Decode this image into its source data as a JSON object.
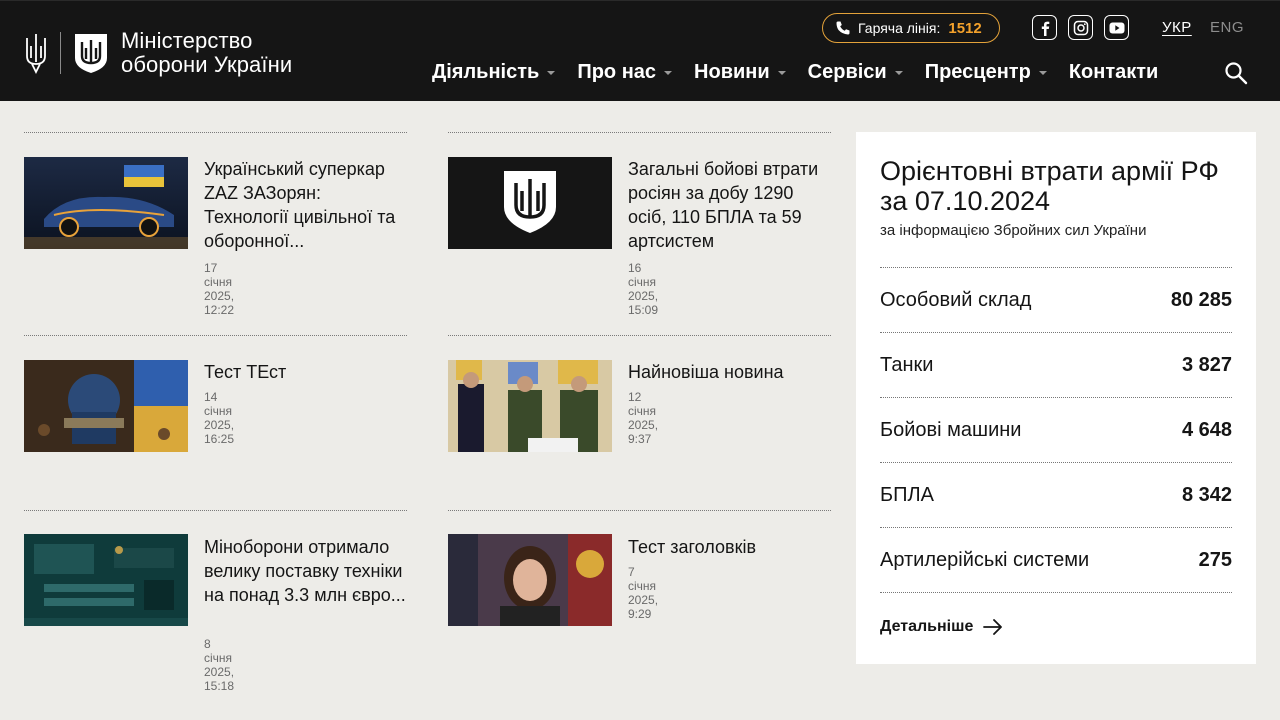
{
  "header": {
    "logo_line1": "Міністерство",
    "logo_line2": "оборони України",
    "hotline_label": "Гаряча лінія:",
    "hotline_number": "1512",
    "lang_ukr": "УКР",
    "lang_eng": "ENG",
    "nav": [
      {
        "label": "Діяльність",
        "dropdown": true
      },
      {
        "label": "Про нас",
        "dropdown": true
      },
      {
        "label": "Новини",
        "dropdown": true
      },
      {
        "label": "Сервіси",
        "dropdown": true
      },
      {
        "label": "Пресцентр",
        "dropdown": true
      },
      {
        "label": "Контакти",
        "dropdown": false
      }
    ]
  },
  "news": [
    {
      "title": "Український суперкар ZAZ ЗАЗорян: Технології цивільної та оборонної...",
      "date": "17 січня 2025, 12:22"
    },
    {
      "title": "Загальні бойові втрати росіян за добу 1290 осіб, 110 БПЛА та 59 артсистем",
      "date": "16 січня 2025, 15:09"
    },
    {
      "title": "Тест ТЕст",
      "date": "14 січня 2025, 16:25"
    },
    {
      "title": "Найновіша новина",
      "date": "12 січня 2025, 9:37"
    },
    {
      "title": "Міноборони отримало велику поставку техніки на понад 3.3 млн євро...",
      "date": "8 січня 2025, 15:18"
    },
    {
      "title": "Тест заголовків",
      "date": "7 січня 2025, 9:29"
    }
  ],
  "losses": {
    "title": "Орієнтовні втрати армії РФ за 07.10.2024",
    "subtitle": "за інформацією Збройних сил України",
    "rows": [
      {
        "label": "Особовий склад",
        "value": "80 285"
      },
      {
        "label": "Танки",
        "value": "3 827"
      },
      {
        "label": "Бойові машини",
        "value": "4 648"
      },
      {
        "label": "БПЛА",
        "value": "8 342"
      },
      {
        "label": "Артилерійські системи",
        "value": "275"
      }
    ],
    "more_label": "Детальніше"
  },
  "colors": {
    "header_bg": "#151515",
    "accent_orange": "#f3a12b",
    "page_bg": "#edece8"
  }
}
